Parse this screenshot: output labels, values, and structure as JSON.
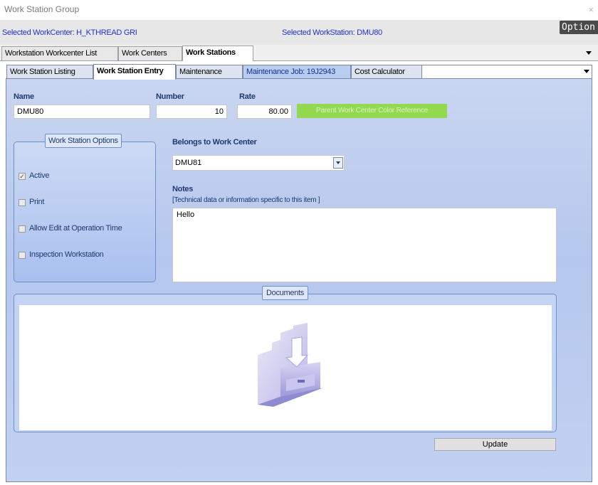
{
  "window": {
    "title": "Work Station Group",
    "close_glyph": "×"
  },
  "infobar": {
    "selected_workcenter": "Selected WorkCenter: H_KTHREAD GRI",
    "selected_workstation": "Selected WorkStation: DMU80",
    "options_label": "Option"
  },
  "outer_tabs": [
    {
      "label": "Workstation Workcenter List",
      "active": false
    },
    {
      "label": "Work Centers",
      "active": false
    },
    {
      "label": "Work Stations",
      "active": true
    }
  ],
  "inner_tabs": [
    {
      "label": "Work Station Listing",
      "active": false
    },
    {
      "label": "Work Station Entry",
      "active": true
    },
    {
      "label": "Maintenance",
      "active": false
    },
    {
      "label": "Maintenance Job: 19J2943",
      "active": false
    },
    {
      "label": "Cost Calculator",
      "active": false
    }
  ],
  "form": {
    "name_label": "Name",
    "name_value": "DMU80",
    "number_label": "Number",
    "number_value": "10",
    "rate_label": "Rate",
    "rate_value": "80.00",
    "parent_color_label": "Parent Work Center Color Reference",
    "parent_color": "#93d94f"
  },
  "options_group": {
    "title": "Work Station Options",
    "items": [
      {
        "label": "Active",
        "checked": true
      },
      {
        "label": "Print",
        "checked": false
      },
      {
        "label": "Allow Edit at Operation Time",
        "checked": false
      },
      {
        "label": "Inspection Workstation",
        "checked": false
      }
    ]
  },
  "belongs": {
    "label": "Belongs to Work Center",
    "selected": "DMU81"
  },
  "notes": {
    "label": "Notes",
    "hint": "[Technical data or information specific to this item ]",
    "value": "Hello"
  },
  "documents": {
    "title": "Documents",
    "icon": "folder-download-icon"
  },
  "update_label": "Update"
}
